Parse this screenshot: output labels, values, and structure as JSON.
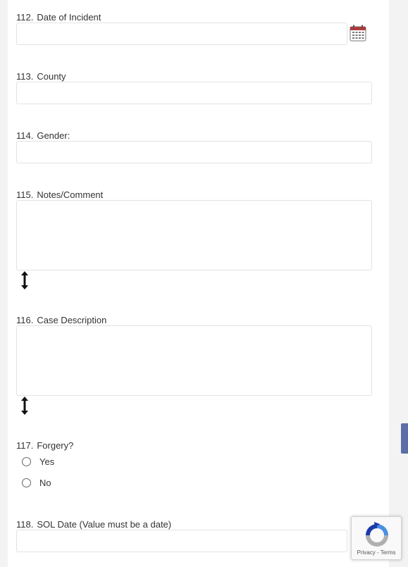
{
  "form": {
    "questions": [
      {
        "num": "112.",
        "label": "Date of Incident",
        "value": ""
      },
      {
        "num": "113.",
        "label": "County",
        "value": ""
      },
      {
        "num": "114.",
        "label": "Gender:",
        "value": ""
      },
      {
        "num": "115.",
        "label": "Notes/Comment",
        "value": ""
      },
      {
        "num": "116.",
        "label": "Case Description",
        "value": ""
      },
      {
        "num": "117.",
        "label": "Forgery?",
        "options": [
          "Yes",
          "No"
        ]
      },
      {
        "num": "118.",
        "label": "SOL Date (Value must be a date)",
        "value": ""
      }
    ]
  },
  "icons": {
    "calendar": "calendar-icon",
    "resize": "resize-handle-icon",
    "recaptcha": "recaptcha-logo-icon"
  },
  "recaptcha": {
    "privacy": "Privacy",
    "separator": " - ",
    "terms": "Terms"
  },
  "colors": {
    "side_tab": "#5b6ea8",
    "field_border": "#e2e2e2",
    "calendar_accent": "#b23b3b"
  }
}
